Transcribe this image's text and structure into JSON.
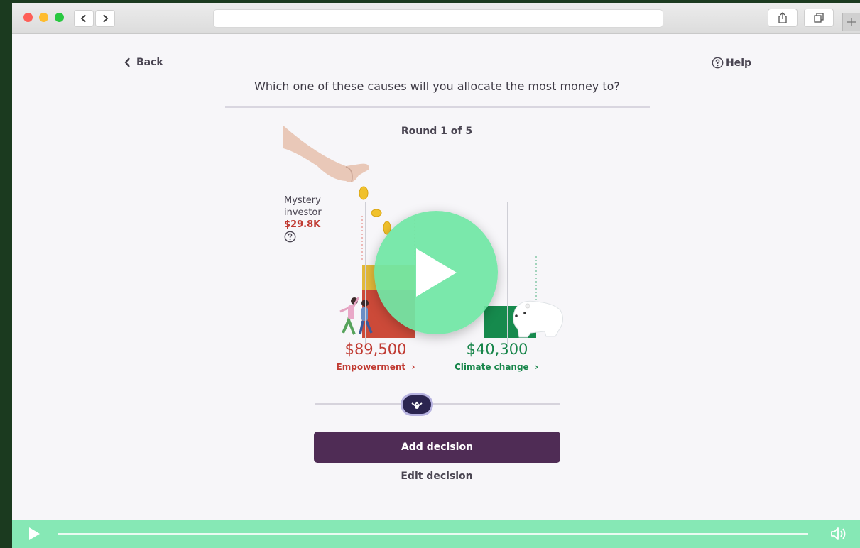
{
  "browser": {
    "back_icon": "chevron-left-icon",
    "forward_icon": "chevron-right-icon",
    "share_icon": "share-icon",
    "tabs_icon": "tabs-icon",
    "new_tab_icon": "plus-icon"
  },
  "nav": {
    "back_label": "Back",
    "help_label": "Help"
  },
  "question": "Which one of these causes will you allocate the most money to?",
  "round": "Round 1 of 5",
  "investor": {
    "line1": "Mystery",
    "line2": "investor",
    "amount": "$29.8K"
  },
  "causes": [
    {
      "amount": "$89,500",
      "label": "Empowerment",
      "color": "#c03a32"
    },
    {
      "amount": "$40,300",
      "label": "Climate change",
      "color": "#17854a"
    }
  ],
  "actions": {
    "add_decision": "Add decision",
    "edit_decision": "Edit decision"
  },
  "colors": {
    "primary_button": "#4f2c55",
    "play_overlay": "#70e6a5",
    "controls_bar": "#86e8b5"
  }
}
